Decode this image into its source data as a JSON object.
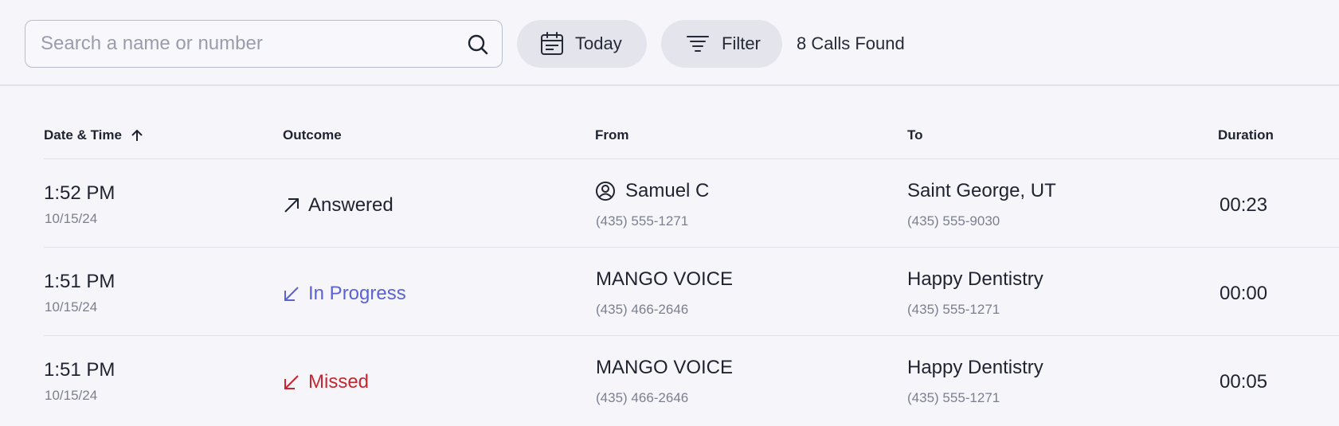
{
  "toolbar": {
    "search_placeholder": "Search a name or number",
    "today_label": "Today",
    "filter_label": "Filter",
    "calls_found": "8 Calls Found"
  },
  "columns": {
    "datetime": "Date & Time",
    "outcome": "Outcome",
    "from": "From",
    "to": "To",
    "duration": "Duration"
  },
  "colors": {
    "answered": "#1f2330",
    "in_progress": "#5a62d6",
    "missed": "#c8262f"
  },
  "rows": [
    {
      "time": "1:52 PM",
      "date": "10/15/24",
      "outcome": "Answered",
      "outcome_icon": "arrow-up-right-icon",
      "from_name": "Samuel C",
      "from_number": "(435) 555-1271",
      "from_icon": "user-circle-icon",
      "to_name": "Saint George, UT",
      "to_number": "(435) 555-9030",
      "duration": "00:23"
    },
    {
      "time": "1:51 PM",
      "date": "10/15/24",
      "outcome": "In Progress",
      "outcome_icon": "arrow-down-left-icon",
      "from_name": "MANGO VOICE",
      "from_number": "(435) 466-2646",
      "to_name": "Happy Dentistry",
      "to_number": "(435) 555-1271",
      "duration": "00:00"
    },
    {
      "time": "1:51 PM",
      "date": "10/15/24",
      "outcome": "Missed",
      "outcome_icon": "arrow-down-left-icon",
      "from_name": "MANGO VOICE",
      "from_number": "(435) 466-2646",
      "to_name": "Happy Dentistry",
      "to_number": "(435) 555-1271",
      "duration": "00:05"
    }
  ]
}
